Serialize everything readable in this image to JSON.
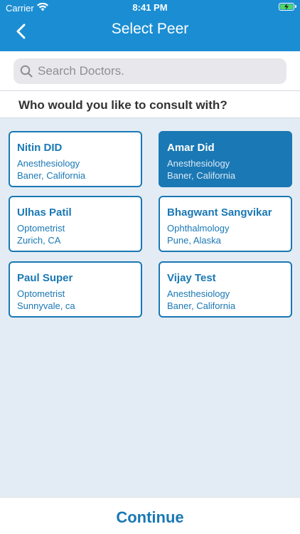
{
  "status_bar": {
    "carrier": "Carrier",
    "time": "8:41 PM",
    "battery_color": "#4cd964"
  },
  "nav": {
    "title": "Select Peer",
    "back_icon": "chevron-left-icon"
  },
  "search": {
    "placeholder": "Search Doctors.",
    "value": ""
  },
  "question": "Who would you like to consult with?",
  "doctors": [
    {
      "name": "Nitin DID",
      "specialty": "Anesthesiology",
      "location": "Baner,  California",
      "selected": false
    },
    {
      "name": "Amar Did",
      "specialty": "Anesthesiology",
      "location": "Baner,  California",
      "selected": true
    },
    {
      "name": "Ulhas Patil",
      "specialty": "Optometrist",
      "location": "Zurich,  CA",
      "selected": false
    },
    {
      "name": "Bhagwant Sangvikar",
      "specialty": "Ophthalmology",
      "location": "Pune,  Alaska",
      "selected": false
    },
    {
      "name": "Paul Super",
      "specialty": "Optometrist",
      "location": "Sunnyvale,  ca",
      "selected": false
    },
    {
      "name": "Vijay Test",
      "specialty": "Anesthesiology",
      "location": "Baner,  California",
      "selected": false
    }
  ],
  "footer": {
    "continue_label": "Continue"
  },
  "colors": {
    "header": "#1b8ed3",
    "accent": "#1a78b4",
    "background": "#e3ecf4"
  }
}
